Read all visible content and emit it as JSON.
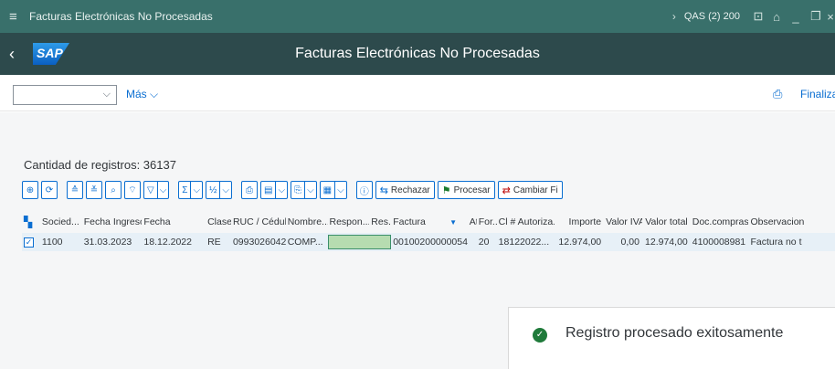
{
  "window": {
    "title": "Facturas Electrónicas No Procesadas",
    "system": "QAS (2) 200",
    "menu_icon": "hamburger-icon"
  },
  "shell": {
    "logo_text": "SAP",
    "page_title": "Facturas Electrónicas No Procesadas"
  },
  "toolbar": {
    "more_label": "Más",
    "exit_label": "Finalizar"
  },
  "content": {
    "record_count": "Cantidad de registros: 36137"
  },
  "alv": {
    "reject_label": "Rechazar",
    "process_label": "Procesar",
    "change_label": "Cambiar Fi"
  },
  "table": {
    "headers": [
      "Socied...",
      "Fecha Ingreso",
      "Fecha",
      "Clase",
      "RUC / Cédula",
      "Nombre...",
      "Respon...",
      "Res...",
      "Factura",
      "At",
      "For...",
      "Cl # Autoriza...",
      "Importe",
      "Valor IVA",
      "Valor total",
      "Doc.compras",
      "Observacion"
    ],
    "rows": [
      {
        "selected": true,
        "cells": [
          "1100",
          "31.03.2023",
          "18.12.2022",
          "RE",
          "09930260420...",
          "COMP...",
          "",
          "",
          "001002000000543",
          "",
          "20",
          "18122022...",
          "12.974,00",
          "0,00",
          "12.974,00",
          "4100008981",
          "Factura no t"
        ]
      }
    ]
  },
  "message": {
    "text": "Registro procesado exitosamente",
    "status": "success",
    "color": "#1f7a3a"
  },
  "colors": {
    "titlebar": "#39706b",
    "shell": "#2d4a4c",
    "accent": "#0a6ed1"
  }
}
